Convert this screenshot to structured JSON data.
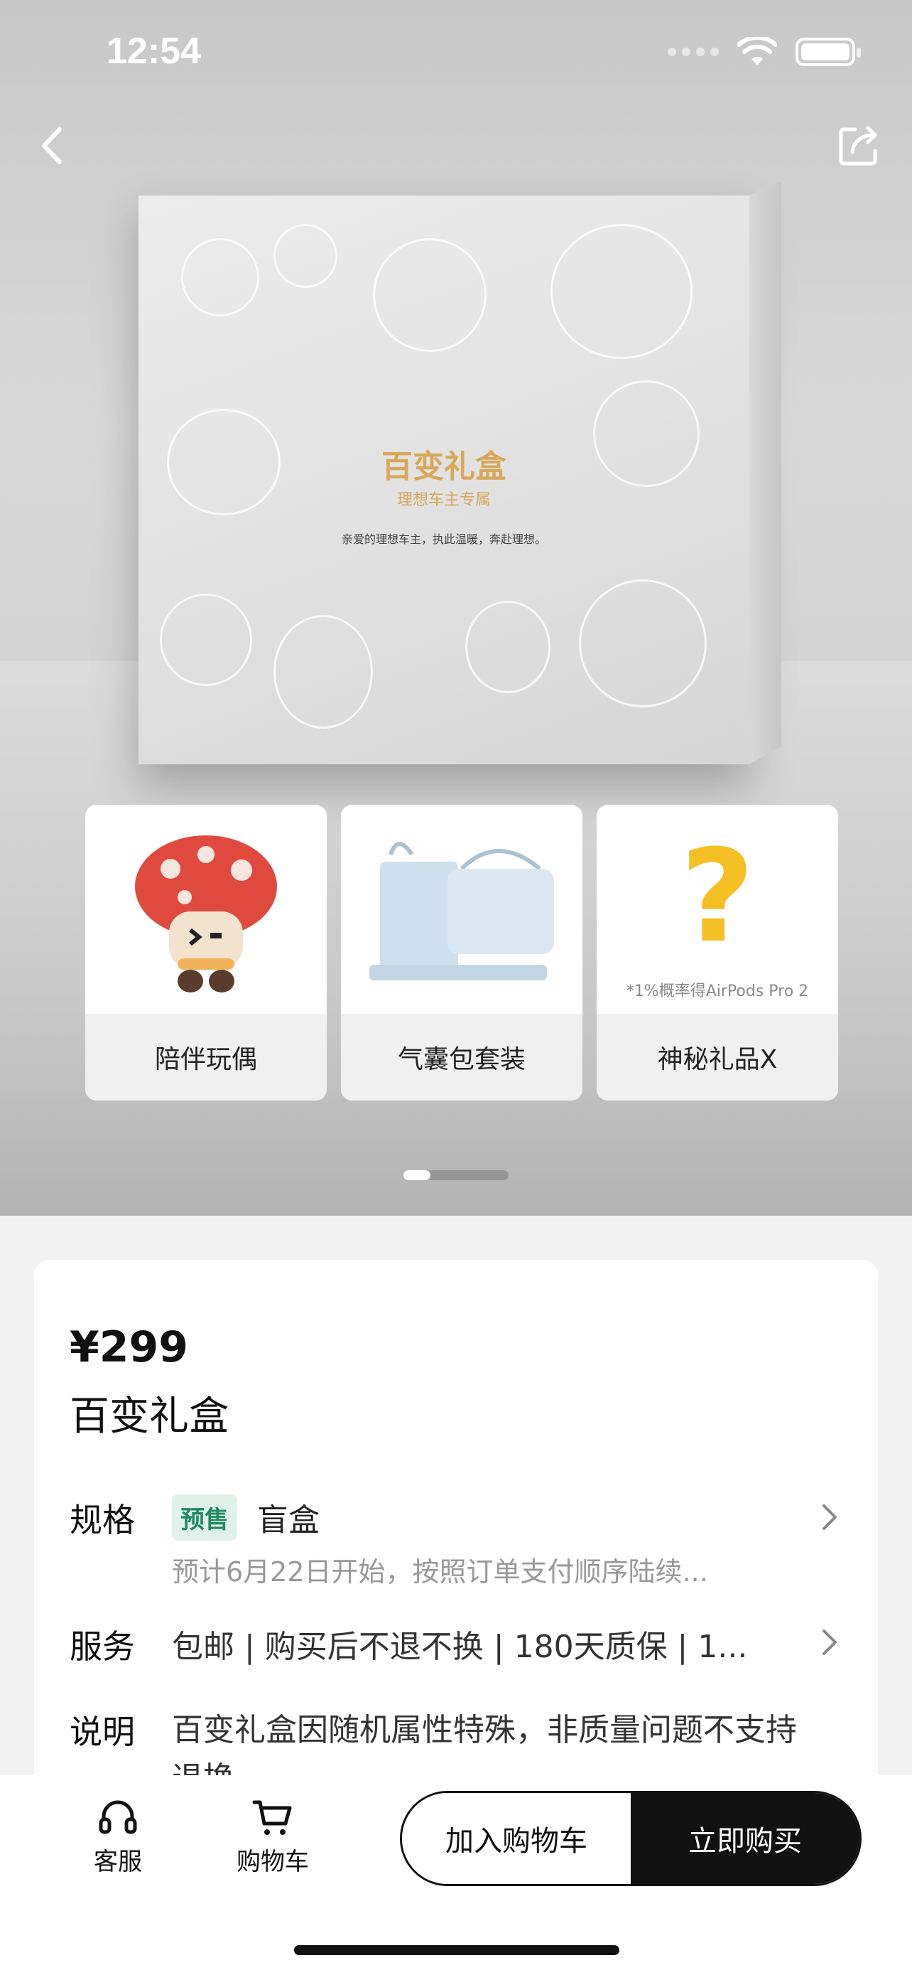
{
  "status": {
    "time": "12:54"
  },
  "box": {
    "title": "百变礼盒",
    "subtitle": "理想车主专属",
    "tagline": "亲爱的理想车主，执此温暖，奔赴理想。"
  },
  "cards": [
    {
      "label": "陪伴玩偶",
      "note": ""
    },
    {
      "label": "气囊包套装",
      "note": ""
    },
    {
      "label": "神秘礼品X",
      "note": "*1%概率得AirPods Pro 2"
    }
  ],
  "product": {
    "price": "¥299",
    "name": "百变礼盒",
    "spec_label": "规格",
    "spec_tag": "预售",
    "spec_value": "盲盒",
    "spec_sub": "预计6月22日开始，按照订单支付顺序陆续...",
    "service_label": "服务",
    "service_value": "包邮 | 购买后不退不换 | 180天质保 | 1...",
    "note_label": "说明",
    "note_value": "百变礼盒因随机属性特殊，非质量问题不支持退换"
  },
  "bottom": {
    "service": "客服",
    "cart": "购物车",
    "add_cart": "加入购物车",
    "buy_now": "立即购买"
  },
  "colors": {
    "tag_bg": "#e0f1ea",
    "tag_fg": "#1f8a60",
    "box_title": "#d8a75a"
  }
}
